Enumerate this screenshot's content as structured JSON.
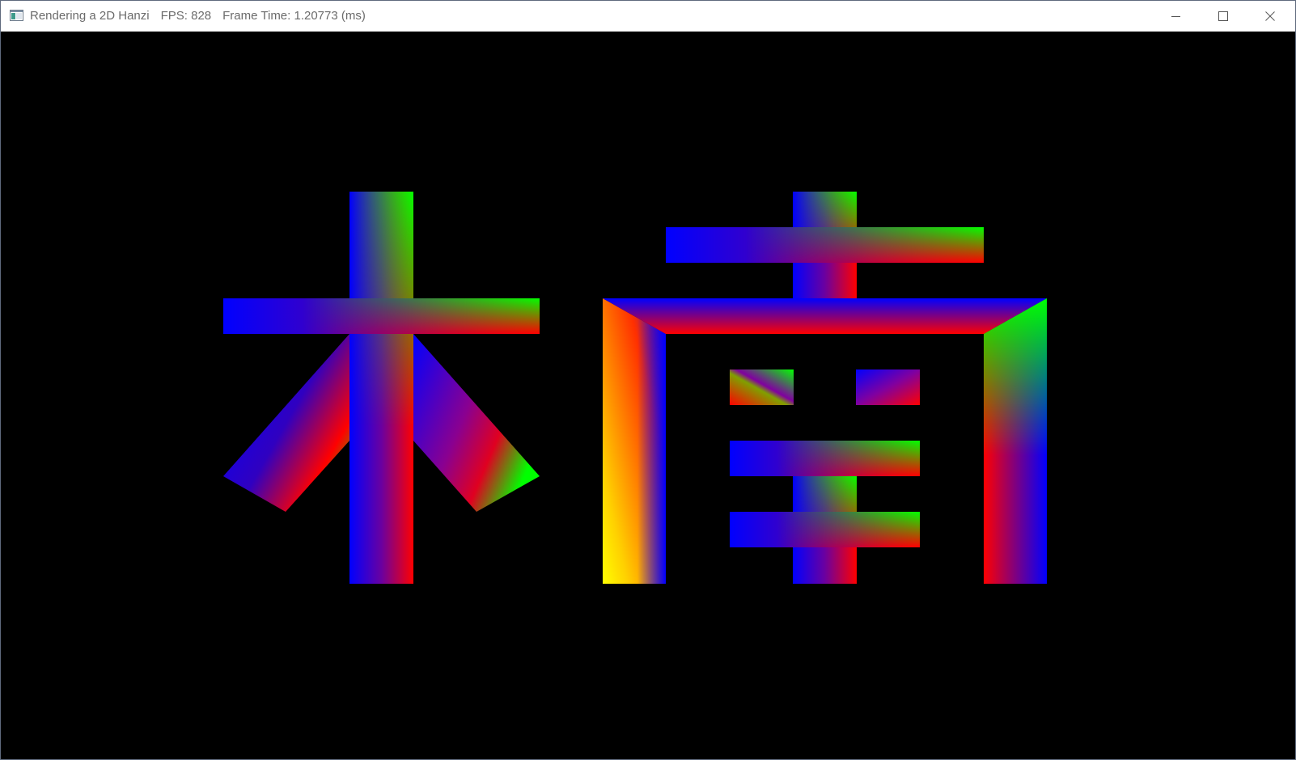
{
  "window": {
    "app_title": "Rendering a 2D Hanzi",
    "fps_text": "FPS: 828",
    "frame_time_text": "Frame Time: 1.20773 (ms)",
    "icon": "app-window-icon",
    "controls": {
      "minimize_icon": "minimize-icon",
      "maximize_icon": "maximize-icon",
      "close_icon": "close-icon"
    }
  },
  "render": {
    "background_color": "#000000",
    "gradient_colors": {
      "blue": "#0000ff",
      "green": "#00ff00",
      "red": "#ff0000",
      "yellow": "#ffff00"
    },
    "characters": [
      "木",
      "南"
    ]
  }
}
